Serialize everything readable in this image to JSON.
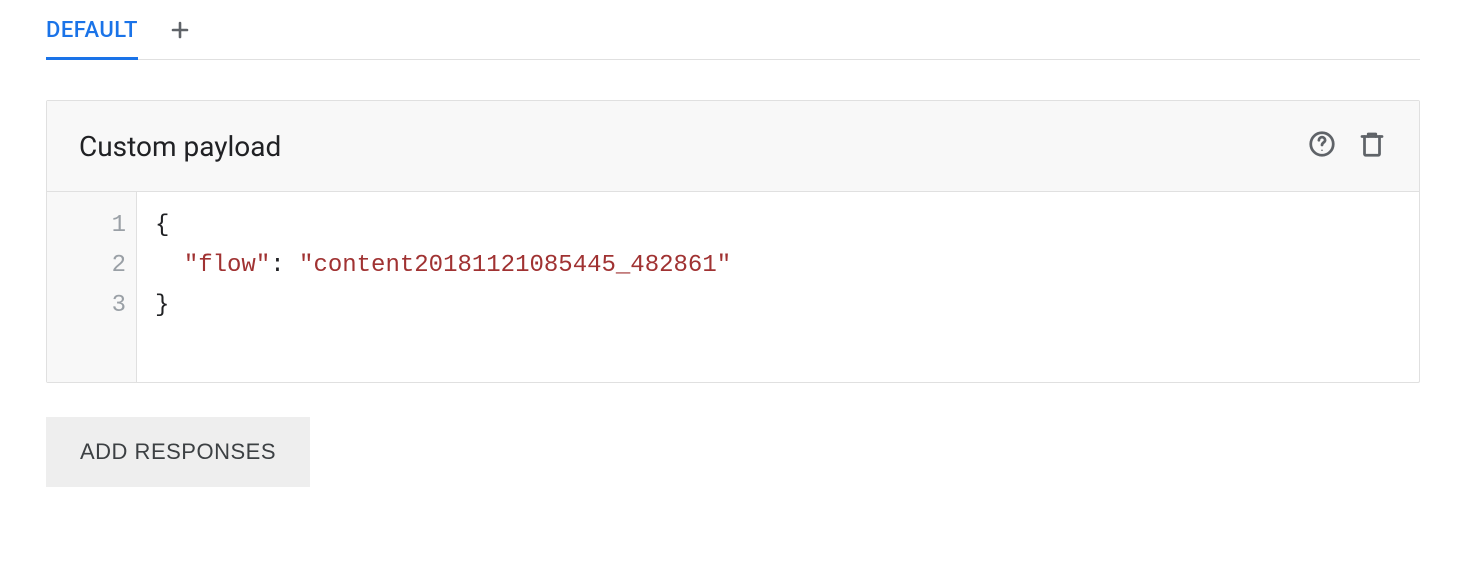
{
  "tabs": {
    "active_label": "DEFAULT"
  },
  "card": {
    "title": "Custom payload"
  },
  "editor": {
    "gutter": [
      "1",
      "2",
      "3"
    ],
    "code_lines": [
      {
        "indent": "",
        "tokens": [
          {
            "t": "{",
            "cls": "j-punc"
          }
        ]
      },
      {
        "indent": "  ",
        "tokens": [
          {
            "t": "\"flow\"",
            "cls": "j-key"
          },
          {
            "t": ": ",
            "cls": "j-punc"
          },
          {
            "t": "\"content20181121085445_482861\"",
            "cls": "j-str"
          }
        ]
      },
      {
        "indent": "",
        "tokens": [
          {
            "t": "}",
            "cls": "j-punc"
          }
        ]
      }
    ],
    "payload_json": {
      "flow": "content20181121085445_482861"
    }
  },
  "buttons": {
    "add_responses": "ADD RESPONSES"
  }
}
